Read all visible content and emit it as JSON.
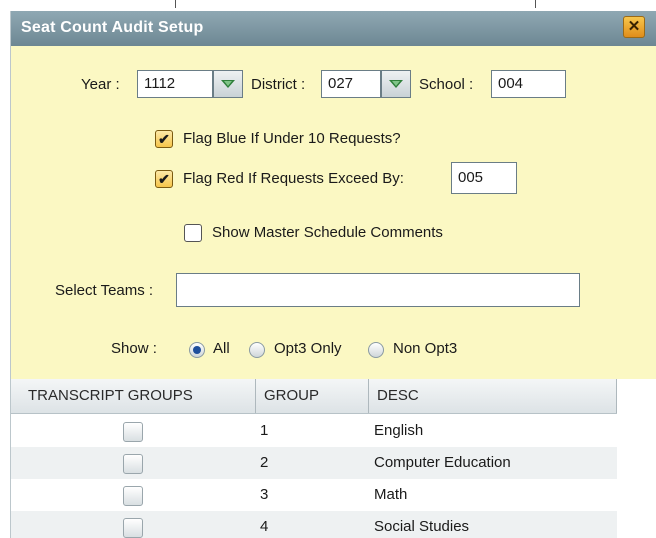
{
  "dialog": {
    "title": "Seat Count Audit Setup",
    "close_label": "✕"
  },
  "form": {
    "year": {
      "label": "Year :",
      "value": "1112"
    },
    "district": {
      "label": "District :",
      "value": "027"
    },
    "school": {
      "label": "School :",
      "value": "004"
    },
    "flag_blue": {
      "label": "Flag Blue If Under 10 Requests?",
      "checked": true,
      "mark": "✔"
    },
    "flag_red": {
      "label": "Flag Red If Requests Exceed By:",
      "checked": true,
      "mark": "✔",
      "value": "005"
    },
    "show_master": {
      "label": "Show Master Schedule Comments",
      "checked": false
    },
    "select_teams": {
      "label": "Select Teams :",
      "value": ""
    },
    "show": {
      "label": "Show :",
      "options": [
        {
          "label": "All",
          "selected": true
        },
        {
          "label": "Opt3 Only",
          "selected": false
        },
        {
          "label": "Non Opt3",
          "selected": false
        }
      ]
    }
  },
  "grid": {
    "columns": [
      "TRANSCRIPT GROUPS",
      "GROUP",
      "DESC"
    ],
    "rows": [
      {
        "group": "1",
        "desc": "English",
        "checked": false
      },
      {
        "group": "2",
        "desc": "Computer Education",
        "checked": false
      },
      {
        "group": "3",
        "desc": "Math",
        "checked": false
      },
      {
        "group": "4",
        "desc": "Social Studies",
        "checked": false
      }
    ]
  },
  "colors": {
    "form_background": "#fbf8c3",
    "titlebar": "#7a939e",
    "close_button": "#f2b43a",
    "radio_selected": "#1f4f9c",
    "dropdown_arrow": "#2f7f3a"
  },
  "icons": {
    "close": "close-icon",
    "dropdown": "chevron-down-icon"
  }
}
